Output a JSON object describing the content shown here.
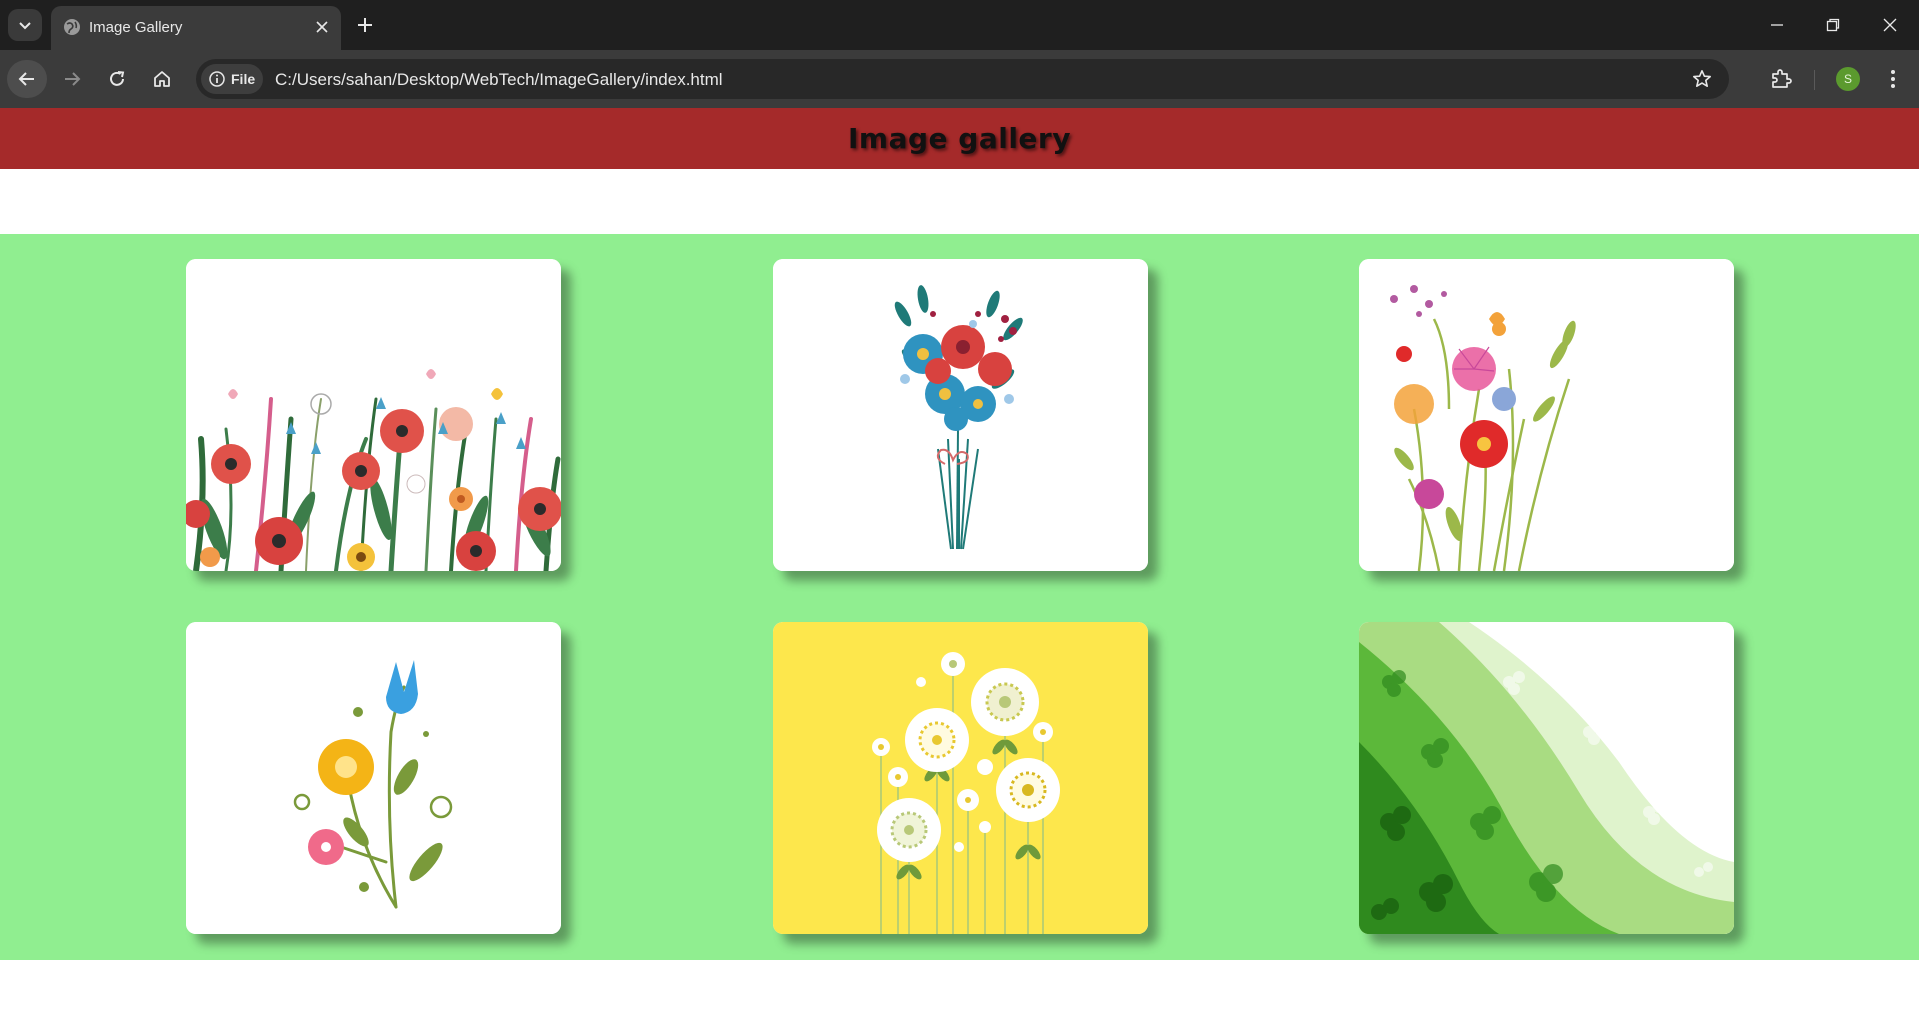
{
  "browser": {
    "tab_title": "Image Gallery",
    "site_chip": "File",
    "url": "C:/Users/sahan/Desktop/WebTech/ImageGallery/index.html",
    "profile_initial": "S",
    "profile_color": "#5b9a2e"
  },
  "page": {
    "title": "Image gallery",
    "header_color": "#a52a2a",
    "gallery_bg": "#90ee90"
  },
  "gallery": {
    "images": [
      {
        "subject": "wildflower meadow with poppies"
      },
      {
        "subject": "blue and red flower bouquet"
      },
      {
        "subject": "red and pink wildflowers"
      },
      {
        "subject": "yellow and blue flower sprig"
      },
      {
        "subject": "white daisies on yellow"
      },
      {
        "subject": "green clover wave pattern"
      }
    ]
  }
}
